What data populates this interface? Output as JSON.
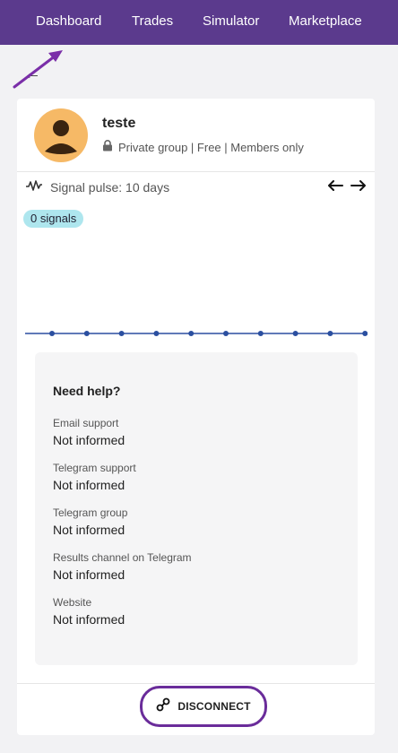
{
  "nav": {
    "links": [
      "Dashboard",
      "Trades",
      "Simulator",
      "Marketplace"
    ]
  },
  "back": {
    "icon": "arrow-left-icon",
    "label": "←"
  },
  "group": {
    "name": "teste",
    "meta": "Private group | Free | Members only",
    "lock_icon": "lock-icon",
    "avatar_icon": "user-avatar-icon"
  },
  "pulse": {
    "label": "Signal pulse: 10 days",
    "prev_icon": "arrow-left-icon",
    "next_icon": "arrow-right-icon"
  },
  "signals": {
    "count_label": "0 signals"
  },
  "chart_data": {
    "type": "line",
    "x": [
      1,
      2,
      3,
      4,
      5,
      6,
      7,
      8,
      9,
      10
    ],
    "values": [
      0,
      0,
      0,
      0,
      0,
      0,
      0,
      0,
      0,
      0
    ],
    "title": "",
    "xlabel": "",
    "ylabel": "",
    "line_color": "#2b4fa0"
  },
  "help": {
    "title": "Need help?",
    "items": [
      {
        "label": "Email support",
        "value": "Not informed"
      },
      {
        "label": "Telegram support",
        "value": "Not informed"
      },
      {
        "label": "Telegram group",
        "value": "Not informed"
      },
      {
        "label": "Results channel on Telegram",
        "value": "Not informed"
      },
      {
        "label": "Website",
        "value": "Not informed"
      }
    ]
  },
  "disconnect": {
    "label": "DISCONNECT",
    "icon": "link-icon"
  },
  "colors": {
    "nav_bg": "#5b3a8d",
    "accent": "#6a2c9a",
    "badge_bg": "#aee6ee",
    "avatar_bg": "#f6b966"
  }
}
